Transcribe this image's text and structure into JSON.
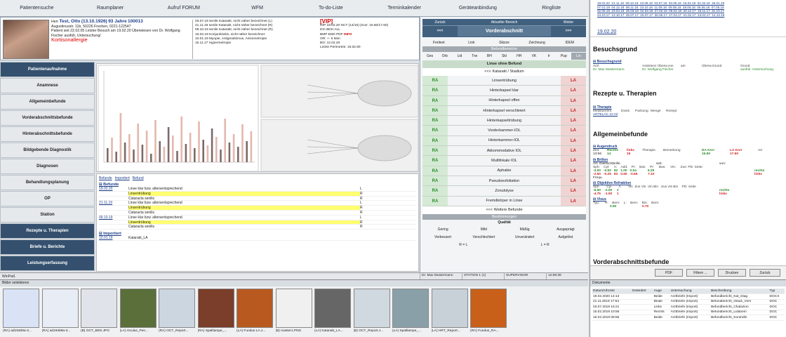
{
  "nav": [
    "Patientensuche",
    "Raumplaner",
    "Aufruf FORUM",
    "WFM",
    "To-do-Liste",
    "Terminkalender",
    "Geräteanbindung",
    "Ringliste"
  ],
  "patient": {
    "prefix": "Herr",
    "name": "Test, Otto",
    "dob": "(13.10.1926)",
    "age": "93 Jahre",
    "id": "100013",
    "line2": "Augustinusstr. 11b, 50226 Frechen, 0221-122547",
    "line3": "Patient seit 22.02.05   Letzter Besuch am 19.02.20  Überwiesen von Dr. Wolfgang",
    "line4": "Fischer       ausfüh. Untersuchung/",
    "allergy": "Kortisonallergie"
  },
  "history": [
    "03.07.19 senile Katarakt, nicht näher bezeichnet (L)",
    "21.11.19 senile Katarakt, nicht näher bezeichnet (R)",
    "09.10.19 senile Katarakt, nicht näher bezeichnet (R)",
    "15.02.19 Konjunktivitis, nicht näher bezeichnet",
    "10.01.19 Myopie, Astigmatismus, Anisometropie",
    "15.11.17 Hypermetropie"
  ],
  "vip": {
    "title": "[VIP]",
    "lines": [
      "IOP 19.02.20 NCT (14/16) (Korr. 16.80/17.60)",
      "DIA BDH ALL",
      "BMP EDD PDF",
      "OR: +- 6 Mon",
      "BG: 12.02.20",
      "Letzte Perimetrie:  15.02.90"
    ],
    "info": "INFO"
  },
  "sidebar": [
    "Patientenaufnahme",
    "Anamnese",
    "Allgemeinbefunde",
    "Vorderabschnittsbefunde",
    "Hinterabschnittsbefunde",
    "Bildgebende Diagnostik",
    "Diagnosen",
    "Behandlungsplanung",
    "OP",
    "Station",
    "Rezepte u. Therapien",
    "Briefe u. Berichte",
    "Leistungserfassung"
  ],
  "lower": {
    "tabs": [
      "Befunde",
      "Importiert",
      "Befund"
    ],
    "befunde_title": "Befunde",
    "rows": [
      {
        "d": "19.02.20",
        "t": "Linse klar bzw. altersentsprechend",
        "e": "L"
      },
      {
        "d": "",
        "t": "Linsentrübung",
        "e": "R",
        "hl": true
      },
      {
        "d": "",
        "t": "Cataracta senilis",
        "e": "R"
      },
      {
        "d": "21.11.19",
        "t": "Linse klar bzw. altersentsprechend",
        "e": "L"
      },
      {
        "d": "",
        "t": "Linsentrübung",
        "e": "R",
        "hl": true
      },
      {
        "d": "",
        "t": "Cataracta senilis",
        "e": "R"
      },
      {
        "d": "09.10.19",
        "t": "Linse klar bzw. altersentsprechend",
        "e": "L"
      },
      {
        "d": "",
        "t": "Linsentrübung",
        "e": "R",
        "hl": true
      },
      {
        "d": "",
        "t": "Cataracta senilis",
        "e": "R"
      }
    ],
    "import_title": "Importiert",
    "import_rows": [
      {
        "d": "10.01.19",
        "t": "Katarakt_LA",
        "e": ""
      }
    ]
  },
  "bef": {
    "zurueck": "Zurück",
    "aktuell": "Aktueller Bereich",
    "weiter": "Weiter",
    "prev": "<<<",
    "area": "Vorderabschnitt",
    "next": ">>>",
    "tabs": [
      "Freitext",
      "Link",
      "Skizze",
      "Zeichnung",
      "IDEM"
    ],
    "bereiche": "Befundbereiche",
    "sub": [
      "Ges",
      "Orb",
      "Lid",
      "Trw",
      "BH",
      "Skl",
      "HH",
      "VK",
      "Ir",
      "Pup",
      "Lin"
    ],
    "headline": "Linse ohne Befund",
    "stadium": "<<< Katarakt / Stadium",
    "ra": "RA",
    "la": "LA",
    "items": [
      "Linsentrübung",
      "Hinterkapsel klar",
      "Hinterkapsel offen",
      "Hinterkapsel verschleiert",
      "Hinterkapseltrübung",
      "Vorderkammer-IOL",
      "Hinterkammer-IOL",
      "Akkommodative IOL",
      "Multifokale IOL",
      "Aphakie",
      "Pseudoexfoliation",
      "Zonulolyse",
      "Fremdkörper in Linse"
    ],
    "more": "<<< Weitere Befunde",
    "bestimmungen": "Bestimmungen",
    "qualitaet": "Qualität",
    "q1": [
      "Gering",
      "Mild",
      "Mäßig",
      "Ausgeprägt"
    ],
    "q2": [
      "Verbessert",
      "Verschlechtert",
      "Unverändert",
      "Aufgelöst"
    ],
    "rl": "R = L",
    "lr": "L = R"
  },
  "status": {
    "left": "WinPat1",
    "doctor": "Dr. Max Mustermann",
    "station": "STATION 1 (1)",
    "role": "SUPERVISOR",
    "time": "12:59:39"
  },
  "bilder": {
    "title": "Bilder selektieren",
    "items": [
      "(RA) ad19489a-3...",
      "(RA) ad19489a-3...",
      "(B) OCT_BDS.JPG",
      "(LA) Oculus_Pen...",
      "(RA) OCT_Report...",
      "(RA) Spaltlampe_...",
      "(LA) Fundus LA.J...",
      "(B) master1.PNG",
      "(LA) Katarakt_LA...",
      "(B) OCT_Report.J...",
      "(LA) Spaltlampe_...",
      "(LA) HRT_Report...",
      "(RA) Fundus_RA..."
    ]
  },
  "right": {
    "dates": [
      "19.02.20  21.11.19  09.10.19  23.08.19  03.07.19  03.06.19  15.02.19  01.02.19  25.01.19",
      "07.01.19  04.12.18  06.11.18  23.10.18  11.09.18  09.08.18  28.06.18  06.06.18  07.05.18",
      "02.05.18  19.04.18  26.03.18  02.03.18  27.02.18  06.02.18  20.12.17  15.11.17  31.10.17",
      "24.10.17  13.10.17  25.07.17  20.07.17  30.05.17  27.03.17  21.02.17  23.02.17  12.12.16"
    ],
    "current": "19.02.20",
    "besuchsgrund": "Besuchsgrund",
    "bg_sub": "Besuchsgrund",
    "bg_cols": [
      "Arzt",
      "Assistenz Überw.von",
      "am",
      "Überw.Grund",
      "Grund"
    ],
    "bg_arzt": "Dr. Max Mustermann",
    "bg_ueber": "Dr. Wolfgang Fischer",
    "bg_grund": "ausfüh. Untersuchung",
    "rezepte": "Rezepte u. Therapien",
    "therapie": "Therapie",
    "th_cols": [
      "Medikament",
      "Dosis",
      "Packung",
      "Menge",
      "Rezept"
    ],
    "th_med": "ARTELAC 10 ml",
    "allgemein": "Allgemeinbefunde",
    "augendruck": "Augendruck",
    "ad_cols": [
      "Zeit",
      "Rechts",
      "links",
      "Therapie",
      "Bemerkung",
      "RA Korr",
      "LA Korr",
      "Art"
    ],
    "ad_vals": [
      "13:56",
      "14",
      "16",
      "16.80",
      "17.60"
    ],
    "brillen": "Brillen",
    "br_art": "Art:  Gleitsichtbrille",
    "br_seit": "seit:",
    "br_von": "von:",
    "br_cols": "Sph:    Cyl:     A:    Add:    Pr:    Bas     Pr:     Bas:     Vis:     Zus: PD: Seite:",
    "br_r": "-3.00   -0.50   82   1.00   0.54            5.29",
    "br_l": "-2.50   -0.25   83   0.50   -0.65           7.10",
    "rechts": "rechts",
    "links": "links",
    "frequ": "Frequ.",
    "objref": "Objektive Refraktion",
    "or_cols": "Sph        Cyl        A        Vis  Zus Vis  Vin Bin   Zus Vis Bin    PD: Seite",
    "or_r": "-5.50    -2.00     2",
    "or_l": "-4.75    -1.00     1",
    "visus": "Visus",
    "vis_cols": "Typ:      R:    Bem:    L:    Bem:    Bin:    Bem:",
    "vis_r": "0.60",
    "vis_l": "0.70",
    "vorder": "Vorderabschnittsbefunde",
    "buttons": [
      "PDF",
      "Filtern ...",
      "Drucken",
      "Zurück"
    ]
  },
  "docs": {
    "title": "Dokumente",
    "cols": [
      "Datum/Uhrzeit",
      "Geändert",
      "Auge",
      "Untersuchung",
      "Beschreibung",
      "Typ"
    ],
    "rows": [
      [
        "19.02.2020 14:13",
        "",
        "Beide",
        "Arztbriefe (Import)",
        "Befundbericht_Kat_Diag",
        "DOCX"
      ],
      [
        "21.11.2019 17:54",
        "",
        "Beide",
        "Arztbriefe (Import)",
        "Befundbericht_Glauk_Vors",
        "DOC"
      ],
      [
        "03.07.2019 16:21",
        "",
        "Links",
        "Arztbriefe (Import)",
        "Befundbericht_Chalazion",
        "DOC"
      ],
      [
        "15.02.2019 10:56",
        "",
        "Rechts",
        "Arztbriefe (Import)",
        "Befundbericht_Liddoem",
        "DOC"
      ],
      [
        "15.02.2019 08:56",
        "",
        "Beide",
        "Arztbriefe (Import)",
        "Befundbericht_Kontrolle",
        "DOC"
      ]
    ]
  }
}
